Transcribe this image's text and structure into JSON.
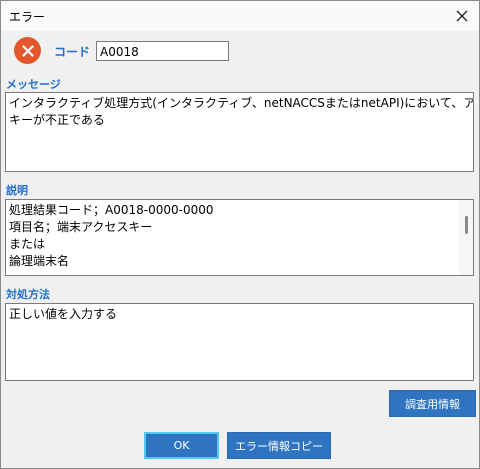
{
  "window": {
    "title": "エラー"
  },
  "header": {
    "code_label": "コード",
    "code_value": "A0018"
  },
  "message": {
    "label": "メッセージ",
    "lines": [
      "インタラクティブ処理方式(インタラクティブ、netNACCSまたはnetAPI)において、アクセス",
      "キーが不正である"
    ]
  },
  "description": {
    "label": "説明",
    "lines": [
      "処理結果コード；A0018-0000-0000",
      "項目名；端末アクセスキー",
      "または",
      "論理端末名"
    ]
  },
  "remedy": {
    "label": "対処方法",
    "lines": [
      "正しい値を入力する"
    ]
  },
  "buttons": {
    "debug_info": "調査用情報",
    "ok": "OK",
    "copy_error": "エラー情報コピー"
  },
  "colors": {
    "accent": "#1f6fd0",
    "button": "#2f74c0",
    "error_icon": "#e2572c"
  }
}
